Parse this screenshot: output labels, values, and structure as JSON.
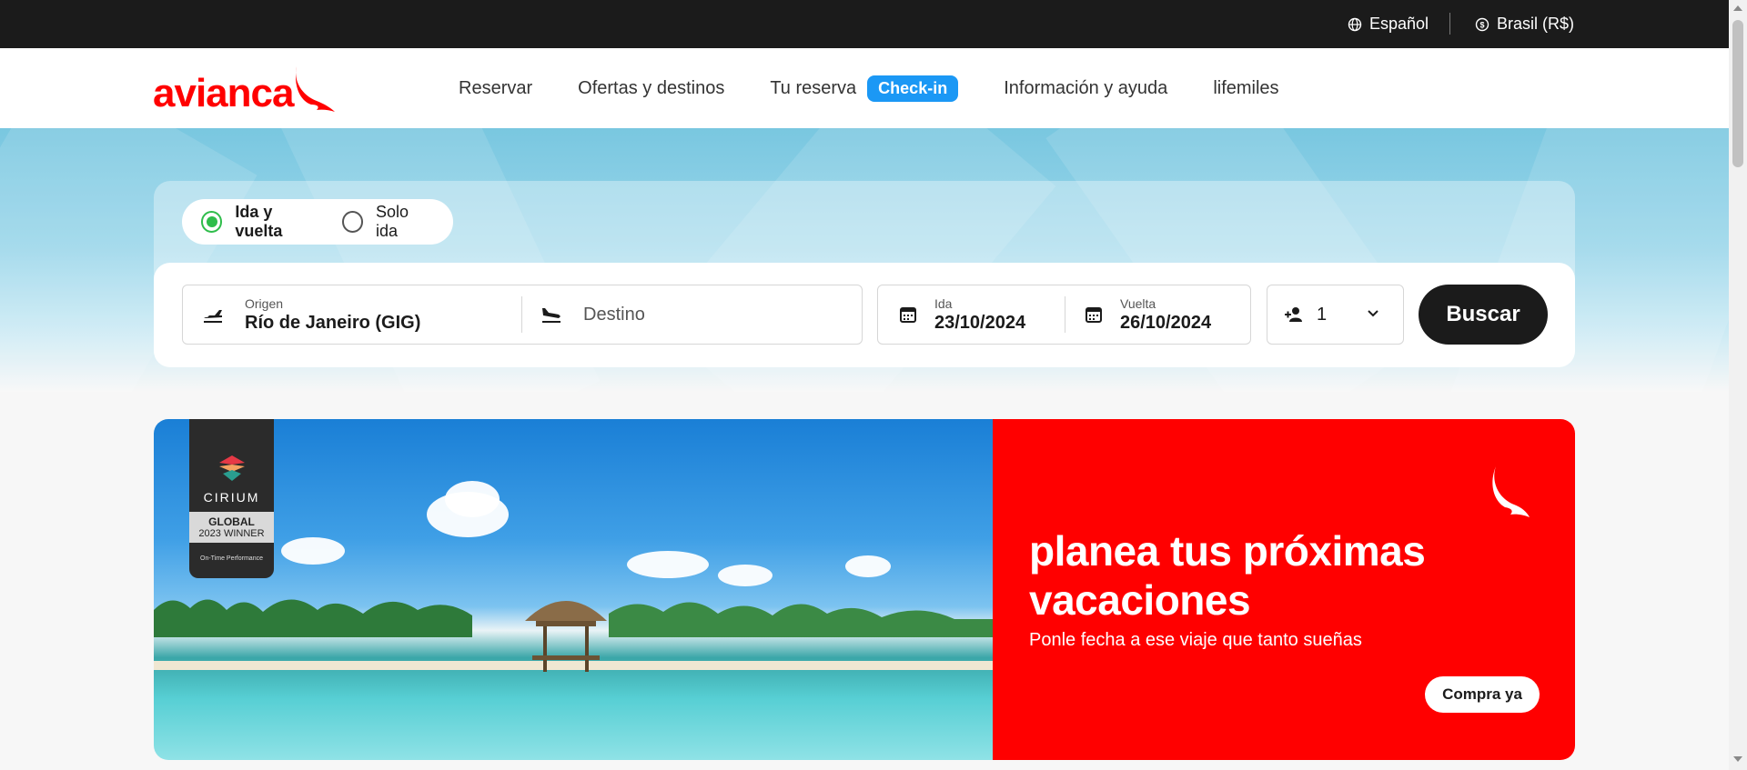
{
  "topbar": {
    "language": "Español",
    "language_icon": "globe-icon",
    "country": "Brasil (R$)",
    "country_icon": "currency-icon"
  },
  "header": {
    "logo_text": "avianca",
    "nav": {
      "reservar": "Reservar",
      "ofertas": "Ofertas y destinos",
      "tu_reserva": "Tu reserva",
      "checkin": "Check-in",
      "info": "Información y ayuda",
      "lifemiles": "lifemiles"
    }
  },
  "search": {
    "trip_types": {
      "round": "Ida y vuelta",
      "oneway": "Solo ida",
      "selected": "round"
    },
    "origin": {
      "label": "Origen",
      "value": "Río de Janeiro  (GIG)",
      "icon": "plane-takeoff-icon"
    },
    "destination": {
      "placeholder": "Destino",
      "icon": "plane-landing-icon"
    },
    "departure": {
      "label": "Ida",
      "value": "23/10/2024",
      "icon": "calendar-icon"
    },
    "return": {
      "label": "Vuelta",
      "value": "26/10/2024",
      "icon": "calendar-icon"
    },
    "passengers": {
      "value": "1",
      "icon": "add-person-icon"
    },
    "button": "Buscar"
  },
  "banner": {
    "badge": {
      "brand": "CIRIUM",
      "line1": "GLOBAL",
      "line2": "2023 WINNER",
      "line3": "On-Time Performance"
    },
    "title_line1": "planea tus próximas",
    "title_line2": "vacaciones",
    "subtitle": "Ponle fecha a ese viaje que tanto sueñas",
    "cta": "Compra ya"
  },
  "colors": {
    "brand_red": "#ff0000",
    "checkin_blue": "#1b98f5",
    "radio_green": "#2fbd4b",
    "dark": "#1b1b1b"
  }
}
